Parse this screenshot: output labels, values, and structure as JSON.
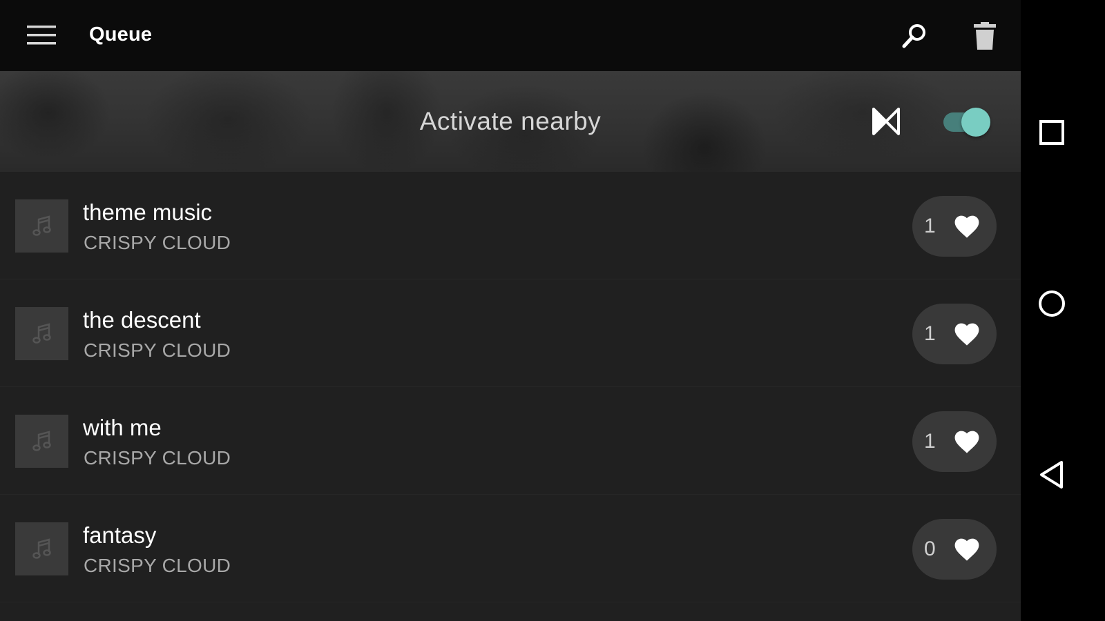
{
  "toolbar": {
    "title": "Queue",
    "menu_icon": "hamburger-menu-icon",
    "search_icon": "search-icon",
    "delete_icon": "trash-icon"
  },
  "banner": {
    "text": "Activate nearby",
    "nearby_icon": "nearby-share-icon",
    "toggle_on": true,
    "accent_color": "#79cdc2"
  },
  "queue": [
    {
      "title": "theme music",
      "artist": "CRISPY CLOUD",
      "votes": "1"
    },
    {
      "title": "the descent",
      "artist": "CRISPY CLOUD",
      "votes": "1"
    },
    {
      "title": "with me",
      "artist": "CRISPY CLOUD",
      "votes": "1"
    },
    {
      "title": "fantasy",
      "artist": "CRISPY CLOUD",
      "votes": "0"
    }
  ],
  "navbar": {
    "items": [
      "recents-icon",
      "home-icon",
      "back-icon"
    ]
  }
}
